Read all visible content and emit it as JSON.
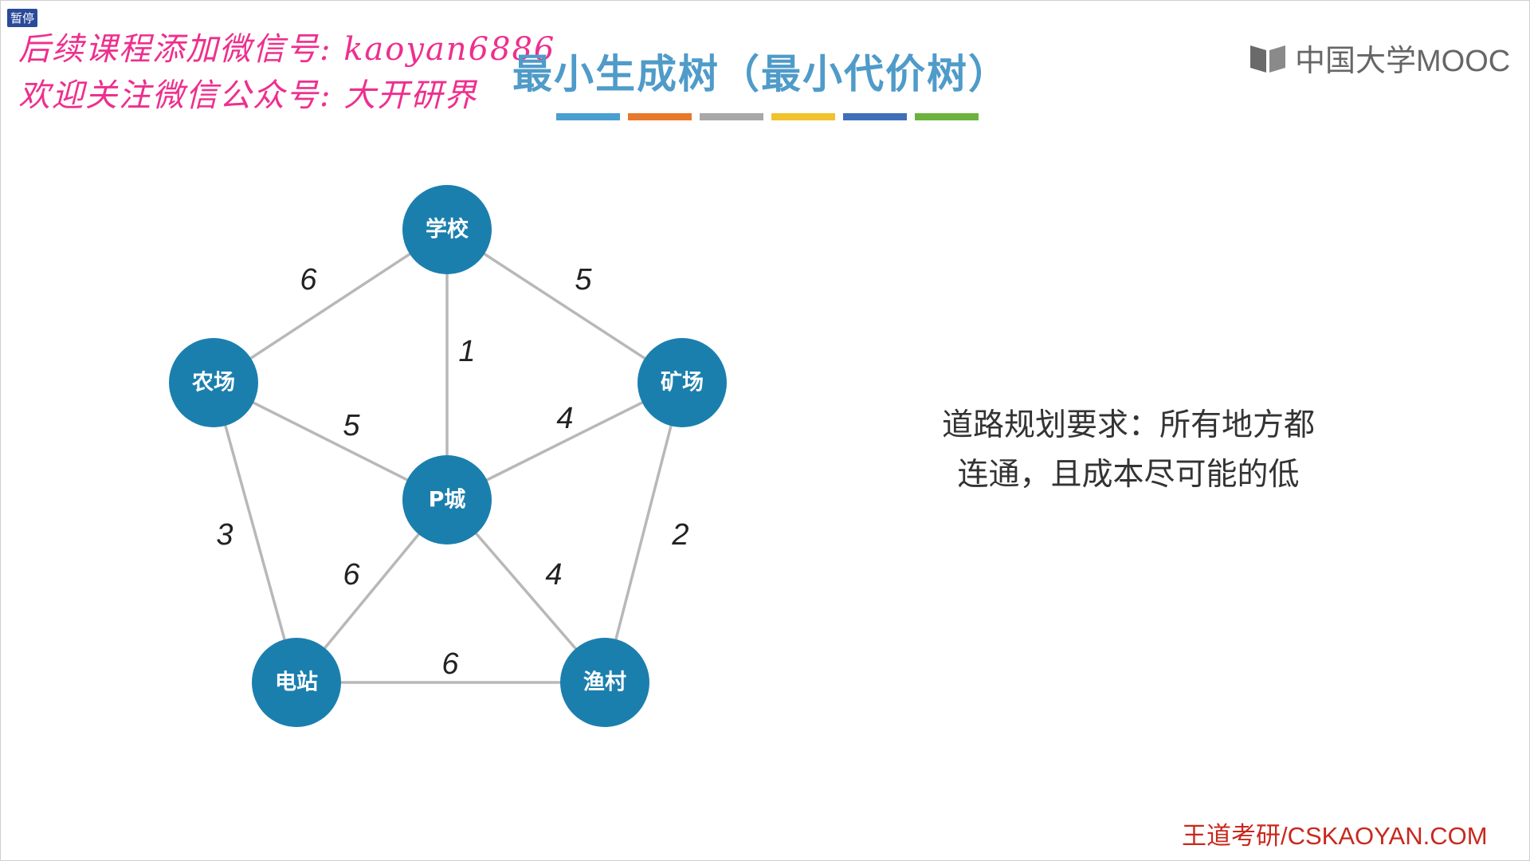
{
  "overlay": {
    "pause_label": "暂停",
    "promo_line1": "后续课程添加微信号: kaoyan6886",
    "promo_line2": "欢迎关注微信公众号: 大开研界"
  },
  "slide": {
    "title": "最小生成树（最小代价树）",
    "title_color": "#4f9bc9",
    "title_bar_colors": [
      "#4a9fd1",
      "#e8792c",
      "#a8a8a8",
      "#f2c12e",
      "#3f6fb8",
      "#6bb33d"
    ],
    "logo_text": "中国大学MOOC",
    "requirement_lines": [
      "道路规划要求：所有地方都",
      "连通，且成本尽可能的低"
    ],
    "footer_brand": "王道考研/CSKAOYAN.COM"
  },
  "graph": {
    "node_color": "#1b7fae",
    "edge_color": "#b8b8b8",
    "nodes": [
      {
        "id": "school",
        "label": "学校"
      },
      {
        "id": "farm",
        "label": "农场"
      },
      {
        "id": "mine",
        "label": "矿场"
      },
      {
        "id": "pcity",
        "label": "P城"
      },
      {
        "id": "station",
        "label": "电站"
      },
      {
        "id": "village",
        "label": "渔村"
      }
    ],
    "edges": [
      {
        "from": "school",
        "to": "farm",
        "weight": "6"
      },
      {
        "from": "school",
        "to": "mine",
        "weight": "5"
      },
      {
        "from": "school",
        "to": "pcity",
        "weight": "1"
      },
      {
        "from": "farm",
        "to": "pcity",
        "weight": "5"
      },
      {
        "from": "mine",
        "to": "pcity",
        "weight": "4"
      },
      {
        "from": "farm",
        "to": "station",
        "weight": "3"
      },
      {
        "from": "mine",
        "to": "village",
        "weight": "2"
      },
      {
        "from": "pcity",
        "to": "station",
        "weight": "6"
      },
      {
        "from": "pcity",
        "to": "village",
        "weight": "4"
      },
      {
        "from": "station",
        "to": "village",
        "weight": "6"
      }
    ]
  }
}
